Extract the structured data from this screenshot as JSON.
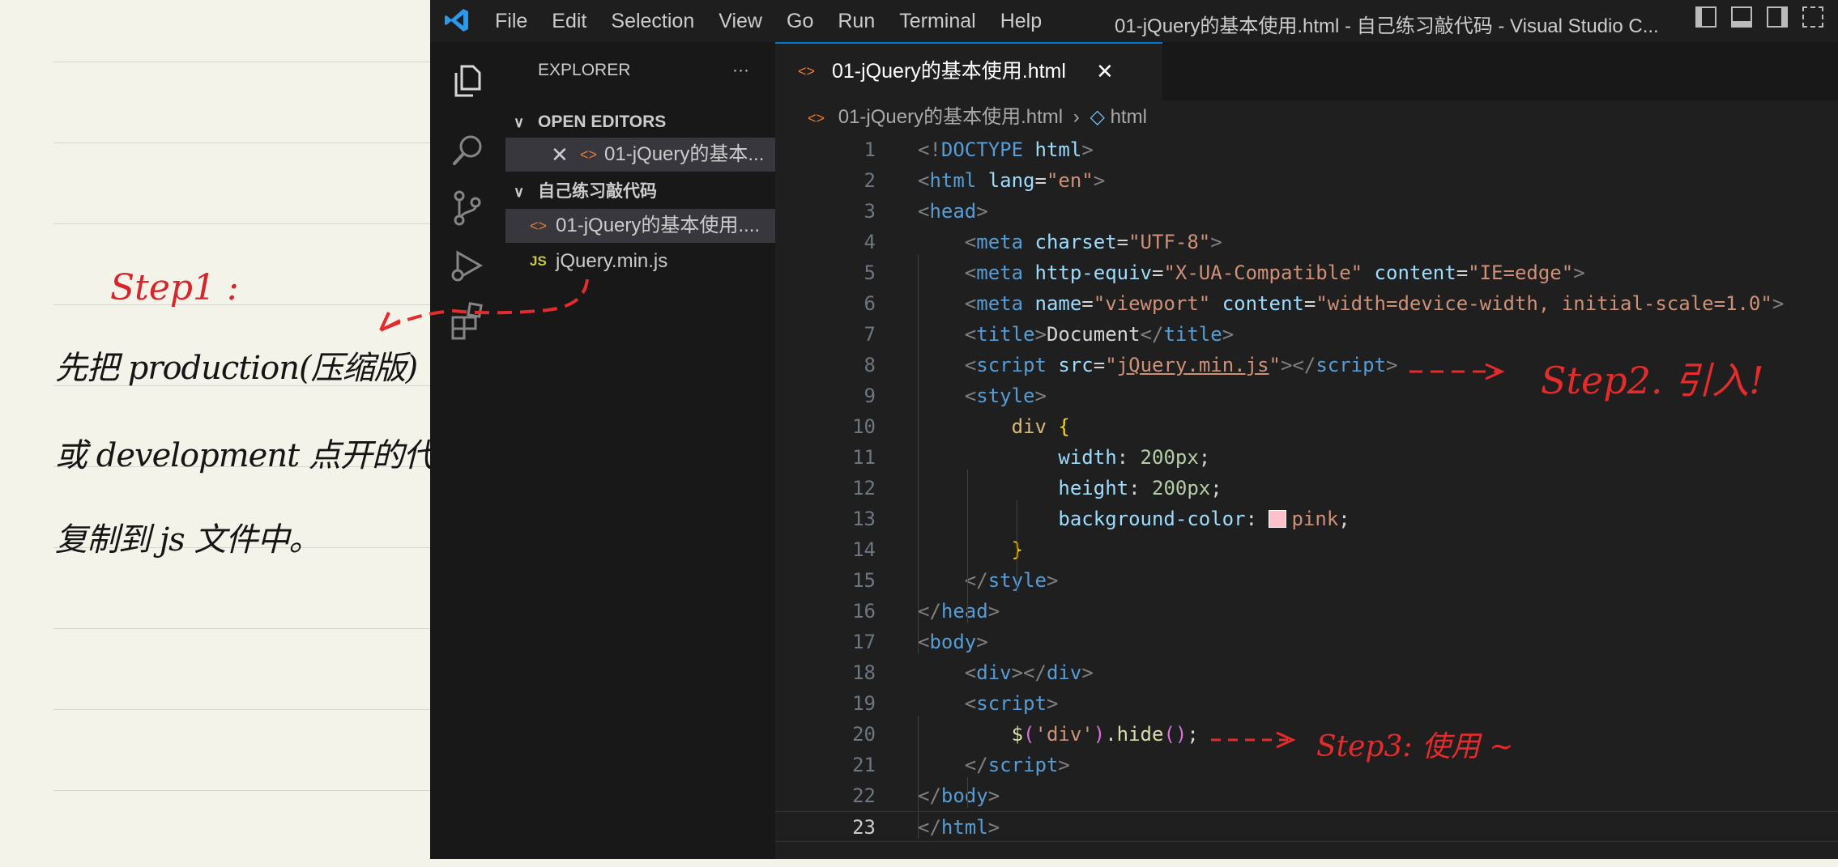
{
  "notes": {
    "step1": "Step1 :",
    "lines": [
      "先把 production(压缩版)",
      "或 development 点开的代码",
      "复制到 js 文件中。"
    ]
  },
  "annotations": {
    "step2": "Step2. 引入!",
    "step3": "Step3: 使用 ~"
  },
  "titlebar": {
    "menu": [
      "File",
      "Edit",
      "Selection",
      "View",
      "Go",
      "Run",
      "Terminal",
      "Help"
    ],
    "window_title": "01-jQuery的基本使用.html - 自己练习敲代码 - Visual Studio C..."
  },
  "explorer": {
    "title": "EXPLORER",
    "more": "···",
    "open_editors_header": "OPEN EDITORS",
    "open_editor_item": "01-jQuery的基本...",
    "folder_header": "自己练习敲代码",
    "files": [
      {
        "name": "01-jQuery的基本使用....",
        "icon": "html-file-icon"
      },
      {
        "name": "jQuery.min.js",
        "icon": "js-file-icon"
      }
    ]
  },
  "editor": {
    "tab_label": "01-jQuery的基本使用.html",
    "breadcrumb_file": "01-jQuery的基本使用.html",
    "breadcrumb_symbol": "html",
    "current_line": 23,
    "lines": [
      [
        [
          "t",
          "<!"
        ],
        [
          "tg",
          "DOCTYPE"
        ],
        [
          "pl",
          " "
        ],
        [
          "at",
          "html"
        ],
        [
          "t",
          ">"
        ]
      ],
      [
        [
          "t",
          "<"
        ],
        [
          "tg",
          "html"
        ],
        [
          "pl",
          " "
        ],
        [
          "at",
          "lang"
        ],
        [
          "pl",
          "="
        ],
        [
          "s",
          "\"en\""
        ],
        [
          "t",
          ">"
        ]
      ],
      [
        [
          "t",
          "<"
        ],
        [
          "tg",
          "head"
        ],
        [
          "t",
          ">"
        ]
      ],
      [
        [
          "pl",
          "    "
        ],
        [
          "t",
          "<"
        ],
        [
          "tg",
          "meta"
        ],
        [
          "pl",
          " "
        ],
        [
          "at",
          "charset"
        ],
        [
          "pl",
          "="
        ],
        [
          "s",
          "\"UTF-8\""
        ],
        [
          "t",
          ">"
        ]
      ],
      [
        [
          "pl",
          "    "
        ],
        [
          "t",
          "<"
        ],
        [
          "tg",
          "meta"
        ],
        [
          "pl",
          " "
        ],
        [
          "at",
          "http-equiv"
        ],
        [
          "pl",
          "="
        ],
        [
          "s",
          "\"X-UA-Compatible\""
        ],
        [
          "pl",
          " "
        ],
        [
          "at",
          "content"
        ],
        [
          "pl",
          "="
        ],
        [
          "s",
          "\"IE=edge\""
        ],
        [
          "t",
          ">"
        ]
      ],
      [
        [
          "pl",
          "    "
        ],
        [
          "t",
          "<"
        ],
        [
          "tg",
          "meta"
        ],
        [
          "pl",
          " "
        ],
        [
          "at",
          "name"
        ],
        [
          "pl",
          "="
        ],
        [
          "s",
          "\"viewport\""
        ],
        [
          "pl",
          " "
        ],
        [
          "at",
          "content"
        ],
        [
          "pl",
          "="
        ],
        [
          "s",
          "\"width=device-width, initial-scale=1.0\""
        ],
        [
          "t",
          ">"
        ]
      ],
      [
        [
          "pl",
          "    "
        ],
        [
          "t",
          "<"
        ],
        [
          "tg",
          "title"
        ],
        [
          "t",
          ">"
        ],
        [
          "pl",
          "Document"
        ],
        [
          "t",
          "</"
        ],
        [
          "tg",
          "title"
        ],
        [
          "t",
          ">"
        ]
      ],
      [
        [
          "pl",
          "    "
        ],
        [
          "t",
          "<"
        ],
        [
          "tg",
          "script"
        ],
        [
          "pl",
          " "
        ],
        [
          "at",
          "src"
        ],
        [
          "pl",
          "="
        ],
        [
          "s",
          "\""
        ],
        [
          "su",
          "jQuery.min.js"
        ],
        [
          "s",
          "\""
        ],
        [
          "t",
          "></"
        ],
        [
          "tg",
          "script"
        ],
        [
          "t",
          ">"
        ]
      ],
      [
        [
          "pl",
          "    "
        ],
        [
          "t",
          "<"
        ],
        [
          "tg",
          "style"
        ],
        [
          "t",
          ">"
        ]
      ],
      [
        [
          "pl",
          "        "
        ],
        [
          "sel",
          "div"
        ],
        [
          "pl",
          " "
        ],
        [
          "br",
          "{"
        ]
      ],
      [
        [
          "pl",
          "            "
        ],
        [
          "pr",
          "width"
        ],
        [
          "pl",
          ": "
        ],
        [
          "nm",
          "200px"
        ],
        [
          "pl",
          ";"
        ]
      ],
      [
        [
          "pl",
          "            "
        ],
        [
          "pr",
          "height"
        ],
        [
          "pl",
          ": "
        ],
        [
          "nm",
          "200px"
        ],
        [
          "pl",
          ";"
        ]
      ],
      [
        [
          "pl",
          "            "
        ],
        [
          "pr",
          "background-color"
        ],
        [
          "pl",
          ": "
        ],
        [
          "sw",
          ""
        ],
        [
          "s",
          "pink"
        ],
        [
          "pl",
          ";"
        ]
      ],
      [
        [
          "pl",
          "        "
        ],
        [
          "br",
          "}"
        ]
      ],
      [
        [
          "pl",
          "    "
        ],
        [
          "t",
          "</"
        ],
        [
          "tg",
          "style"
        ],
        [
          "t",
          ">"
        ]
      ],
      [
        [
          "t",
          "</"
        ],
        [
          "tg",
          "head"
        ],
        [
          "t",
          ">"
        ]
      ],
      [
        [
          "t",
          "<"
        ],
        [
          "tg",
          "body"
        ],
        [
          "t",
          ">"
        ]
      ],
      [
        [
          "pl",
          "    "
        ],
        [
          "t",
          "<"
        ],
        [
          "tg",
          "div"
        ],
        [
          "t",
          "></"
        ],
        [
          "tg",
          "div"
        ],
        [
          "t",
          ">"
        ]
      ],
      [
        [
          "pl",
          "    "
        ],
        [
          "t",
          "<"
        ],
        [
          "tg",
          "script"
        ],
        [
          "t",
          ">"
        ]
      ],
      [
        [
          "pl",
          "        "
        ],
        [
          "fn",
          "$"
        ],
        [
          "pu",
          "("
        ],
        [
          "s",
          "'div'"
        ],
        [
          "pu",
          ")"
        ],
        [
          "pl",
          "."
        ],
        [
          "fn",
          "hide"
        ],
        [
          "pu",
          "()"
        ],
        [
          "pl",
          ";"
        ]
      ],
      [
        [
          "pl",
          "    "
        ],
        [
          "t",
          "</"
        ],
        [
          "tg",
          "script"
        ],
        [
          "t",
          ">"
        ]
      ],
      [
        [
          "t",
          "</"
        ],
        [
          "tg",
          "body"
        ],
        [
          "t",
          ">"
        ]
      ],
      [
        [
          "t",
          "</"
        ],
        [
          "tg",
          "html"
        ],
        [
          "t",
          ">"
        ]
      ]
    ]
  },
  "colors": {
    "annotation": "#e52b2b",
    "notebook_bg": "#f4f3e9",
    "accent": "#0078d4",
    "swatch_pink": "#ffc0cb"
  }
}
